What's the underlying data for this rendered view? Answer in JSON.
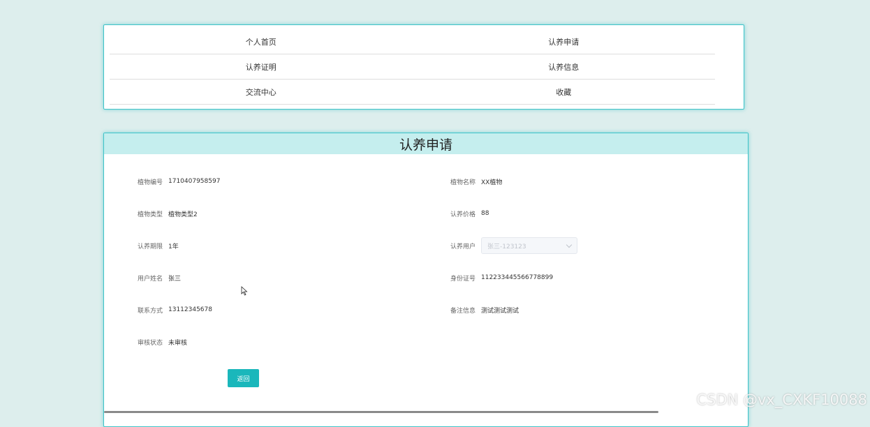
{
  "nav": {
    "rows": [
      [
        "个人首页",
        "认养申请"
      ],
      [
        "认养证明",
        "认养信息"
      ],
      [
        "交流中心",
        "收藏"
      ]
    ]
  },
  "form": {
    "title": "认养申请",
    "fields": {
      "plant_id": {
        "label": "植物编号",
        "value": "1710407958597"
      },
      "plant_name": {
        "label": "植物名称",
        "value": "XX植物"
      },
      "plant_type": {
        "label": "植物类型",
        "value": "植物类型2"
      },
      "price": {
        "label": "认养价格",
        "value": "88"
      },
      "period": {
        "label": "认养期限",
        "value": "1年"
      },
      "user": {
        "label": "认养用户",
        "value": "张三-123123"
      },
      "user_name": {
        "label": "用户姓名",
        "value": "张三"
      },
      "id_number": {
        "label": "身份证号",
        "value": "112233445566778899"
      },
      "contact": {
        "label": "联系方式",
        "value": "13112345678"
      },
      "remark": {
        "label": "备注信息",
        "value": "测试测试测试"
      },
      "status": {
        "label": "审核状态",
        "value": "未审核"
      }
    },
    "back_label": "返回"
  },
  "watermark": "CSDN @vx_CXKF10088",
  "colors": {
    "background": "#ddeeed",
    "accent": "#1ab7bb",
    "header_bg": "#c5eeee",
    "border": "#3ec3c8"
  }
}
